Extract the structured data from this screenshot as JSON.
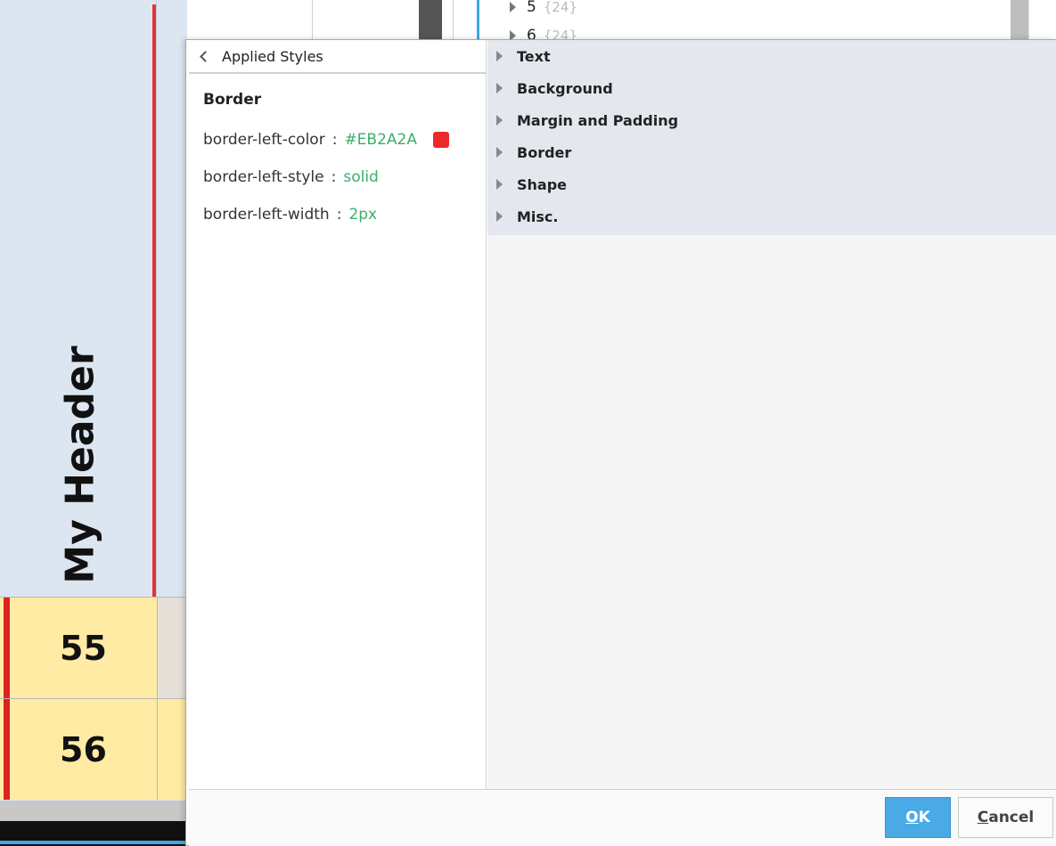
{
  "background_table": {
    "header_label": "My Header",
    "rows": [
      {
        "value": "55"
      },
      {
        "value": "56"
      }
    ]
  },
  "tree": {
    "items": [
      {
        "index": "5",
        "meta": "{24}"
      },
      {
        "index": "6",
        "meta": "{24}"
      }
    ]
  },
  "dialog": {
    "back_label": "Applied Styles",
    "section_title": "Border",
    "properties": [
      {
        "name": "border-left-color",
        "separator": ":",
        "value": "#EB2A2A",
        "swatch_color": "#EB2A2A"
      },
      {
        "name": "border-left-style",
        "separator": ":",
        "value": "solid"
      },
      {
        "name": "border-left-width",
        "separator": ":",
        "value": "2px"
      }
    ],
    "categories": [
      {
        "label": "Text"
      },
      {
        "label": "Background"
      },
      {
        "label": "Margin and Padding"
      },
      {
        "label": "Border"
      },
      {
        "label": "Shape"
      },
      {
        "label": "Misc."
      }
    ],
    "ok": {
      "mnemonic": "O",
      "rest": "K"
    },
    "cancel": {
      "mnemonic": "C",
      "rest": "ancel"
    }
  },
  "colors": {
    "accent_blue": "#4AAAE6",
    "value_green": "#3DAE6A",
    "border_red": "#EB2A2A",
    "row_yellow": "#FFEBA3",
    "header_blue": "#DCE6F1"
  }
}
